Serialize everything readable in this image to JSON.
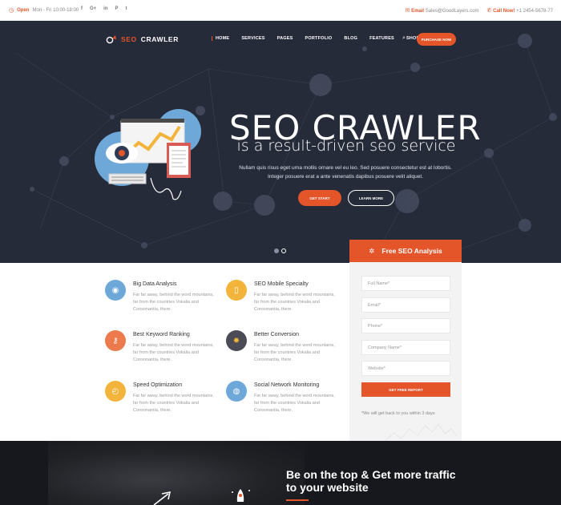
{
  "topbar": {
    "open_label": "Open",
    "open_hours": "Mon - Fri 10:00-18:00",
    "socials": [
      "f",
      "G+",
      "in",
      "P",
      "t"
    ],
    "email_label": "Email",
    "email": "Sales@GoodLayers.com",
    "call_label": "Call Now!",
    "phone": "+1 2454-5678-77"
  },
  "header": {
    "logo_seo": "SEO",
    "logo_crawler": "CRAWLER",
    "nav": [
      "HOME",
      "SERVICES",
      "PAGES",
      "PORTFOLIO",
      "BLOG",
      "FEATURES",
      "SHOP"
    ],
    "purchase_label": "PURCHASE NOW"
  },
  "hero": {
    "title": "SEO CRAWLER",
    "subtitle": "is a result-driven seo service",
    "description": "Nullam quis risus eget urna mollis ornare vel eu leo. Sed posuere consectetur est at lobortis. Integer posuere erat a ante venenatis dapibus posuere velit aliquet.",
    "get_start": "GET START",
    "learn_more": "LEARN MORE",
    "slides": 2,
    "active_slide": 2
  },
  "features": [
    {
      "title": "Big Data Analysis",
      "desc": "Far far away, behind the word mountains, far from the countries Vokalia and Consonantia, there.",
      "color": "#6da8d8",
      "icon": "data-icon"
    },
    {
      "title": "SEO Mobile Specialty",
      "desc": "Far far away, behind the word mountains, far from the countries Vokalia and Consonantia, there.",
      "color": "#f2b43a",
      "icon": "mobile-icon"
    },
    {
      "title": "Best Keyword Ranking",
      "desc": "Far far away, behind the word mountains, far from the countries Vokalia and Consonantia, there.",
      "color": "#ec7a4c",
      "icon": "key-icon"
    },
    {
      "title": "Better Conversion",
      "desc": "Far far away, behind the word mountains, far from the countries Vokalia and Consonantia, there.",
      "color": "#4b4b55",
      "icon": "gear-icon"
    },
    {
      "title": "Speed Optimization",
      "desc": "Far far away, behind the word mountains, far from the countries Vokalia and Consonantia, there.",
      "color": "#f2b43a",
      "icon": "stopwatch-icon"
    },
    {
      "title": "Social Network Monitoring",
      "desc": "Far far away, behind the word mountains, far from the countries Vokalia and Consonantia, there.",
      "color": "#6da8d8",
      "icon": "globe-icon"
    }
  ],
  "analysis": {
    "title": "Free SEO Analysis",
    "fields": [
      "Full Name*",
      "Email*",
      "Phone*",
      "Company Name*",
      "Website*"
    ],
    "button": "GET FREE REPORT",
    "note": "*We will get back to you within 3 days"
  },
  "band": {
    "line1": "Be on the top & Get more traffic",
    "line2": "to your website"
  },
  "colors": {
    "accent": "#e4552a",
    "hero_bg": "#262b3a"
  }
}
